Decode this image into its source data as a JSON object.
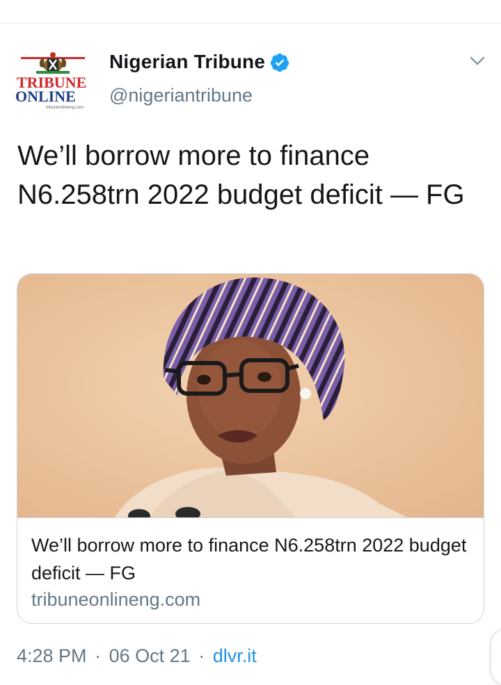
{
  "tweet": {
    "author": {
      "name": "Nigerian Tribune",
      "handle": "@nigeriantribune",
      "verified": true,
      "avatar_logo_text": [
        "TRIBUNE",
        "ONLINE",
        "tribuneonlineng.com"
      ]
    },
    "text": "We’ll borrow more to finance N6.258trn 2022 budget deficit — FG",
    "card": {
      "title": "We’ll borrow more to finance N6.258trn 2022 budget deficit — FG",
      "domain": "tribuneonlineng.com"
    },
    "meta": {
      "time": "4:28 PM",
      "date": "06 Oct 21",
      "source": "dlvr.it",
      "separator": "·"
    }
  },
  "colors": {
    "text": "#14171a",
    "muted": "#657786",
    "link": "#1b95e0",
    "verified": "#1da1f2",
    "brand_red": "#d0272c",
    "brand_blue": "#1d3e8a"
  },
  "icons": {
    "verified": "verified-badge-icon",
    "caret": "chevron-down-icon"
  }
}
